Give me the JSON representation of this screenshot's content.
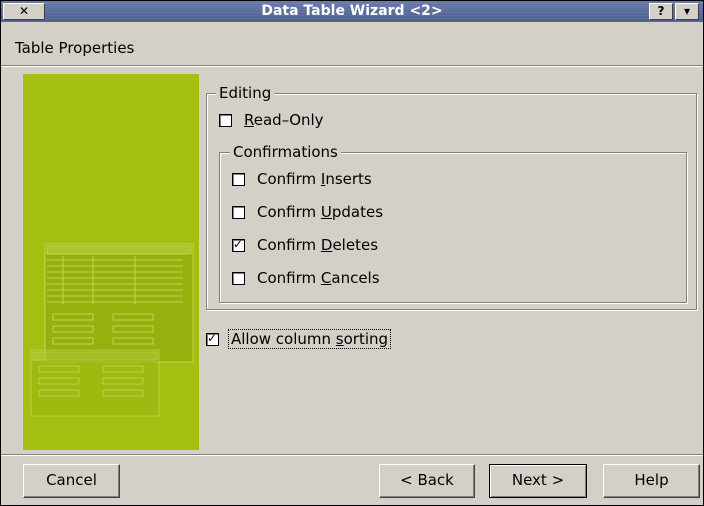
{
  "window": {
    "title": "Data Table Wizard <2>",
    "close_glyph": "✕",
    "help_glyph": "?",
    "menu_glyph": "▾"
  },
  "page": {
    "heading": "Table Properties"
  },
  "editing": {
    "legend": "Editing",
    "read_only": {
      "pre": "",
      "key": "R",
      "post": "ead–Only",
      "checked": false
    }
  },
  "confirmations": {
    "legend": "Confirmations",
    "items": [
      {
        "pre": "Confirm ",
        "key": "I",
        "post": "nserts",
        "checked": false
      },
      {
        "pre": "Confirm ",
        "key": "U",
        "post": "pdates",
        "checked": false
      },
      {
        "pre": "Confirm ",
        "key": "D",
        "post": "eletes",
        "checked": true
      },
      {
        "pre": "Confirm ",
        "key": "C",
        "post": "ancels",
        "checked": false
      }
    ]
  },
  "sorting": {
    "pre": "Allow column ",
    "key": "s",
    "post": "orting",
    "checked": true
  },
  "buttons": {
    "cancel": "Cancel",
    "back": "< Back",
    "next": "Next >",
    "help": "Help"
  },
  "check_glyph": "✓",
  "colors": {
    "illustration": "#a4bf12",
    "titlebar": "#5a6b9c"
  }
}
